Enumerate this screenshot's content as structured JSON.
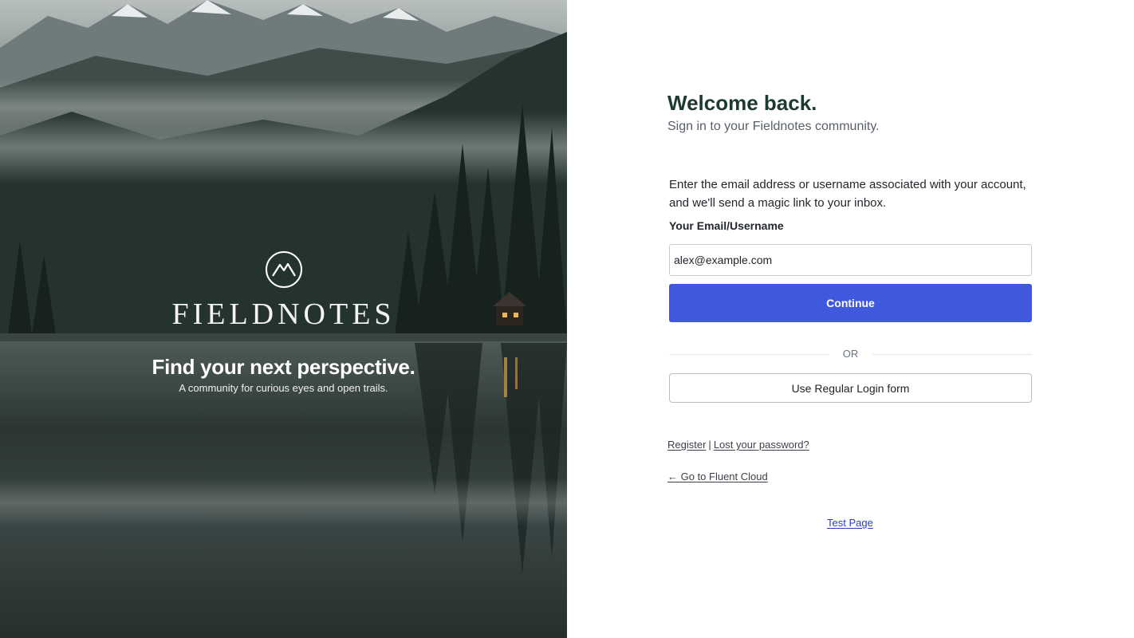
{
  "hero": {
    "brand": "FIELDNOTES",
    "tagline": "Find your next perspective.",
    "subtagline": "A community for curious eyes and open trails.",
    "logo_icon": "mountain-circle-icon"
  },
  "signin": {
    "title": "Welcome back.",
    "subtitle": "Sign in to your Fieldnotes community.",
    "instructions": "Enter the email address or username associated with your account, and we'll send a magic link to your inbox.",
    "field_label": "Your Email/Username",
    "email_value": "alex@example.com",
    "continue_label": "Continue",
    "or_label": "OR",
    "regular_login_label": "Use Regular Login form"
  },
  "links": {
    "register": "Register",
    "separator": "|",
    "lost_password": "Lost your password?",
    "back": "← Go to Fluent Cloud",
    "test_page": "Test Page"
  },
  "colors": {
    "accent": "#3f58de",
    "heading": "#1d3a2f",
    "test_link": "#2a3fbf"
  }
}
